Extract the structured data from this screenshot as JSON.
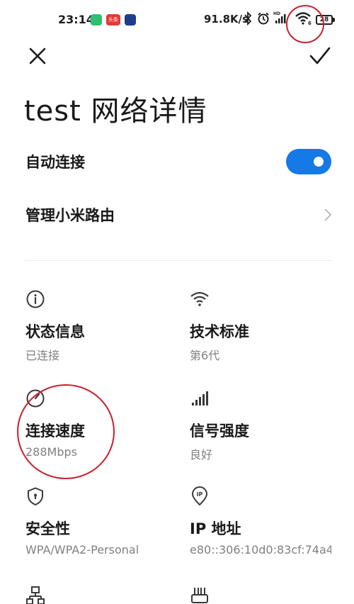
{
  "status_bar": {
    "time": "23:14",
    "news_app_label": "头条",
    "net_speed": "91.8K/s",
    "hd_label": "HD",
    "wifi_gen": "6",
    "battery": "28"
  },
  "header": {
    "title": "test 网络详情"
  },
  "settings": {
    "auto_connect_label": "自动连接",
    "auto_connect_on": true,
    "manage_router_label": "管理小米路由"
  },
  "info": [
    {
      "icon": "info-icon",
      "title": "状态信息",
      "value": "已连接"
    },
    {
      "icon": "wifi-icon",
      "title": "技术标准",
      "value": "第6代"
    },
    {
      "icon": "speedometer-icon",
      "title": "连接速度",
      "value": "288Mbps"
    },
    {
      "icon": "signal-strength-icon",
      "title": "信号强度",
      "value": "良好"
    },
    {
      "icon": "shield-icon",
      "title": "安全性",
      "value": "WPA/WPA2-Personal"
    },
    {
      "icon": "ip-location-icon",
      "title": "IP 地址",
      "value": "e80::306:10d0:83cf:74a4"
    }
  ],
  "colors": {
    "accent": "#1579e6",
    "annotation": "#c8202e",
    "secondary_text": "#808080"
  }
}
